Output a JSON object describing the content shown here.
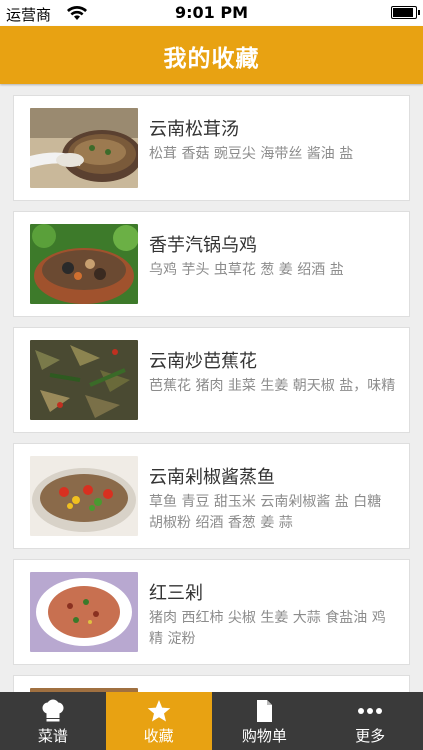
{
  "status_bar": {
    "carrier": "运营商",
    "time": "9:01 PM",
    "battery_level": 0.95
  },
  "header": {
    "title": "我的收藏"
  },
  "favorites": [
    {
      "title": "云南松茸汤",
      "ingredients": "松茸 香菇 豌豆尖 海带丝 酱油 盐"
    },
    {
      "title": "香芋汽锅乌鸡",
      "ingredients": "乌鸡 芋头 虫草花 葱 姜 绍酒 盐"
    },
    {
      "title": "云南炒芭蕉花",
      "ingredients": "芭蕉花 猪肉 韭菜 生姜 朝天椒 盐，味精"
    },
    {
      "title": "云南剁椒酱蒸鱼",
      "ingredients": "草鱼 青豆 甜玉米 云南剁椒酱 盐 白糖 胡椒粉 绍酒 香葱 姜 蒜"
    },
    {
      "title": "红三剁",
      "ingredients": "猪肉 西红柿 尖椒 生姜 大蒜 食盐油 鸡精 淀粉"
    }
  ],
  "tabs": [
    {
      "label": "菜谱",
      "icon": "chef-hat-icon"
    },
    {
      "label": "收藏",
      "icon": "star-icon"
    },
    {
      "label": "购物单",
      "icon": "document-icon"
    },
    {
      "label": "更多",
      "icon": "more-dots-icon"
    }
  ],
  "colors": {
    "accent": "#e8a212",
    "tab_bar": "#3a3a3a",
    "background": "#eeeeee"
  }
}
